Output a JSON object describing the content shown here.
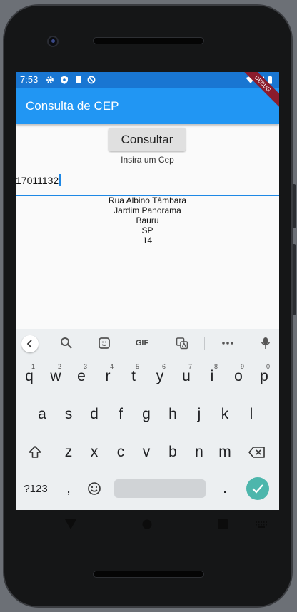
{
  "status_bar": {
    "time": "7:53"
  },
  "debug_banner": "DEBUG",
  "app_bar": {
    "title": "Consulta de CEP"
  },
  "consult_button": "Consultar",
  "cep_field": {
    "label": "Insira um Cep",
    "value": "17011132"
  },
  "result": {
    "street": "Rua Albino Tâmbara",
    "neighborhood": "Jardim Panorama",
    "city": "Bauru",
    "state": "SP",
    "ddd": "14"
  },
  "keyboard": {
    "gif_label": "GIF",
    "row1": [
      "q",
      "w",
      "e",
      "r",
      "t",
      "y",
      "u",
      "i",
      "o",
      "p"
    ],
    "row1_hints": [
      "1",
      "2",
      "3",
      "4",
      "5",
      "6",
      "7",
      "8",
      "9",
      "0"
    ],
    "row2": [
      "a",
      "s",
      "d",
      "f",
      "g",
      "h",
      "j",
      "k",
      "l"
    ],
    "row3": [
      "z",
      "x",
      "c",
      "v",
      "b",
      "n",
      "m"
    ],
    "symbols_key": "?123",
    "comma_key": ",",
    "period_key": "."
  },
  "colors": {
    "app_bar": "#2196f3",
    "status_bar": "#1976d2",
    "accent": "#1e88e5",
    "enter_key": "#4db6ac"
  }
}
